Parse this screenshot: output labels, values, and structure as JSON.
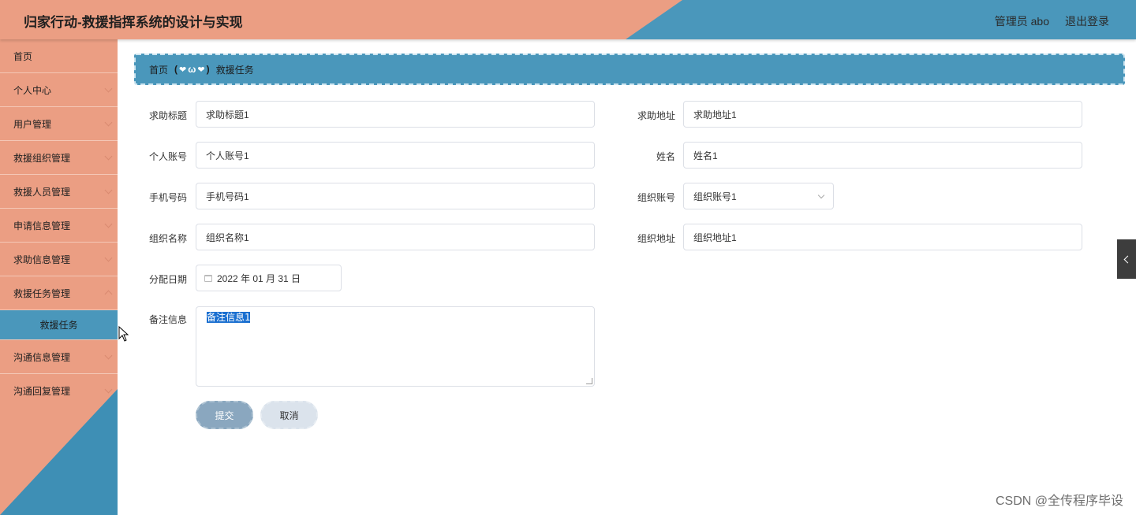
{
  "header": {
    "title": "归家行动-救援指挥系统的设计与实现",
    "admin_label": "管理员 abo",
    "logout_label": "退出登录"
  },
  "sidebar": {
    "items": [
      {
        "label": "首页"
      },
      {
        "label": "个人中心"
      },
      {
        "label": "用户管理"
      },
      {
        "label": "救援组织管理"
      },
      {
        "label": "救援人员管理"
      },
      {
        "label": "申请信息管理"
      },
      {
        "label": "求助信息管理"
      },
      {
        "label": "救援任务管理"
      },
      {
        "label": "救援任务"
      },
      {
        "label": "沟通信息管理"
      },
      {
        "label": "沟通回复管理"
      }
    ]
  },
  "breadcrumb": {
    "home": "首页",
    "separator_open": "(",
    "separator_mid": "ω",
    "separator_close": ")",
    "current": "救援任务"
  },
  "form": {
    "help_title": {
      "label": "求助标题",
      "value": "求助标题1"
    },
    "help_address": {
      "label": "求助地址",
      "value": "求助地址1"
    },
    "personal_account": {
      "label": "个人账号",
      "value": "个人账号1"
    },
    "name": {
      "label": "姓名",
      "value": "姓名1"
    },
    "phone": {
      "label": "手机号码",
      "value": "手机号码1"
    },
    "org_account": {
      "label": "组织账号",
      "value": "组织账号1"
    },
    "org_name": {
      "label": "组织名称",
      "value": "组织名称1"
    },
    "org_address": {
      "label": "组织地址",
      "value": "组织地址1"
    },
    "assign_date": {
      "label": "分配日期",
      "value": "2022 年 01 月 31 日"
    },
    "remarks": {
      "label": "备注信息",
      "value": "备注信息1"
    },
    "submit_label": "提交",
    "cancel_label": "取消"
  },
  "watermark": "CSDN @全传程序毕设",
  "colors": {
    "salmon": "#eb9e83",
    "blue": "#4a97bb",
    "submit": "#8aa7bf",
    "cancel": "#dbe3ec"
  }
}
